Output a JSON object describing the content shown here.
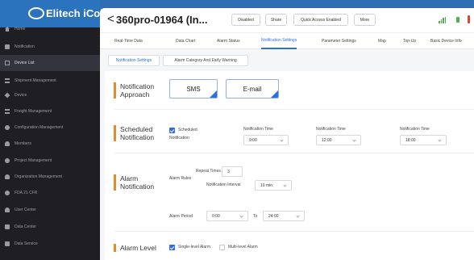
{
  "brand": {
    "name": "Elitech iCold"
  },
  "sidebar": {
    "items": [
      {
        "label": "Home",
        "icon": "home-icon"
      },
      {
        "label": "Notification",
        "icon": "notification-icon"
      },
      {
        "label": "Device List",
        "icon": "device-list-icon",
        "active": true
      },
      {
        "label": "Shipment Management",
        "icon": "shipment-icon"
      },
      {
        "label": "Device",
        "icon": "device-icon"
      },
      {
        "label": "Freight Management",
        "icon": "freight-icon"
      },
      {
        "label": "Configuration Management",
        "icon": "configuration-icon"
      },
      {
        "label": "Members",
        "icon": "members-icon"
      },
      {
        "label": "Project Management",
        "icon": "project-icon"
      },
      {
        "label": "Organization Management",
        "icon": "organization-icon"
      },
      {
        "label": "FDA 21 CFR",
        "icon": "fda-icon"
      },
      {
        "label": "User Center",
        "icon": "user-center-icon"
      },
      {
        "label": "Data Center",
        "icon": "data-center-icon"
      },
      {
        "label": "Data Service",
        "icon": "data-service-icon"
      }
    ]
  },
  "header": {
    "back_symbol": "<",
    "device_title": "360pro-01964  (In...",
    "chips": [
      "Disabled",
      "Share",
      "Quick Access Enabled",
      "More"
    ]
  },
  "tabs": [
    "Real-Time Data",
    "Data Chart",
    "Alarm Status",
    "Notification Settings",
    "Parameter Settings",
    "Map",
    "Top-Up",
    "Basic Device Info"
  ],
  "subtabs": [
    "Notification Settings",
    "Alarm Category And Early Warning"
  ],
  "form": {
    "approach": {
      "title_line1": "Notification",
      "title_line2": "Approach",
      "sms": "SMS",
      "email": "E-mail"
    },
    "scheduled": {
      "title_line1": "Scheduled",
      "title_line2": "Notification",
      "checkbox_line1": "Scheduled",
      "checkbox_line2": "Notification",
      "time_label": "Notification Time",
      "times": [
        "9:00",
        "12:00",
        "18:00"
      ]
    },
    "alarm": {
      "title_line1": "Alarm",
      "title_line2": "Notification",
      "rules_label": "Alarm Rules",
      "repeat_label": "Repeat Times",
      "repeat_value": "3",
      "interval_label": "Notification Interval",
      "interval_value": "10 min",
      "period_label": "Alarm Period",
      "period_from": "0:00",
      "period_to_label": "To",
      "period_to": "24:00"
    },
    "level": {
      "title": "Alarm Level",
      "single": "Single-level Alarm",
      "multi": "Multi-level Alarm"
    }
  },
  "colors": {
    "accent": "#2f6fd8",
    "section_marker": "#e68a2e",
    "sidebar_bg": "#1f1f23",
    "brand_bg": "#2b74bd",
    "signal": "#4cb050"
  }
}
